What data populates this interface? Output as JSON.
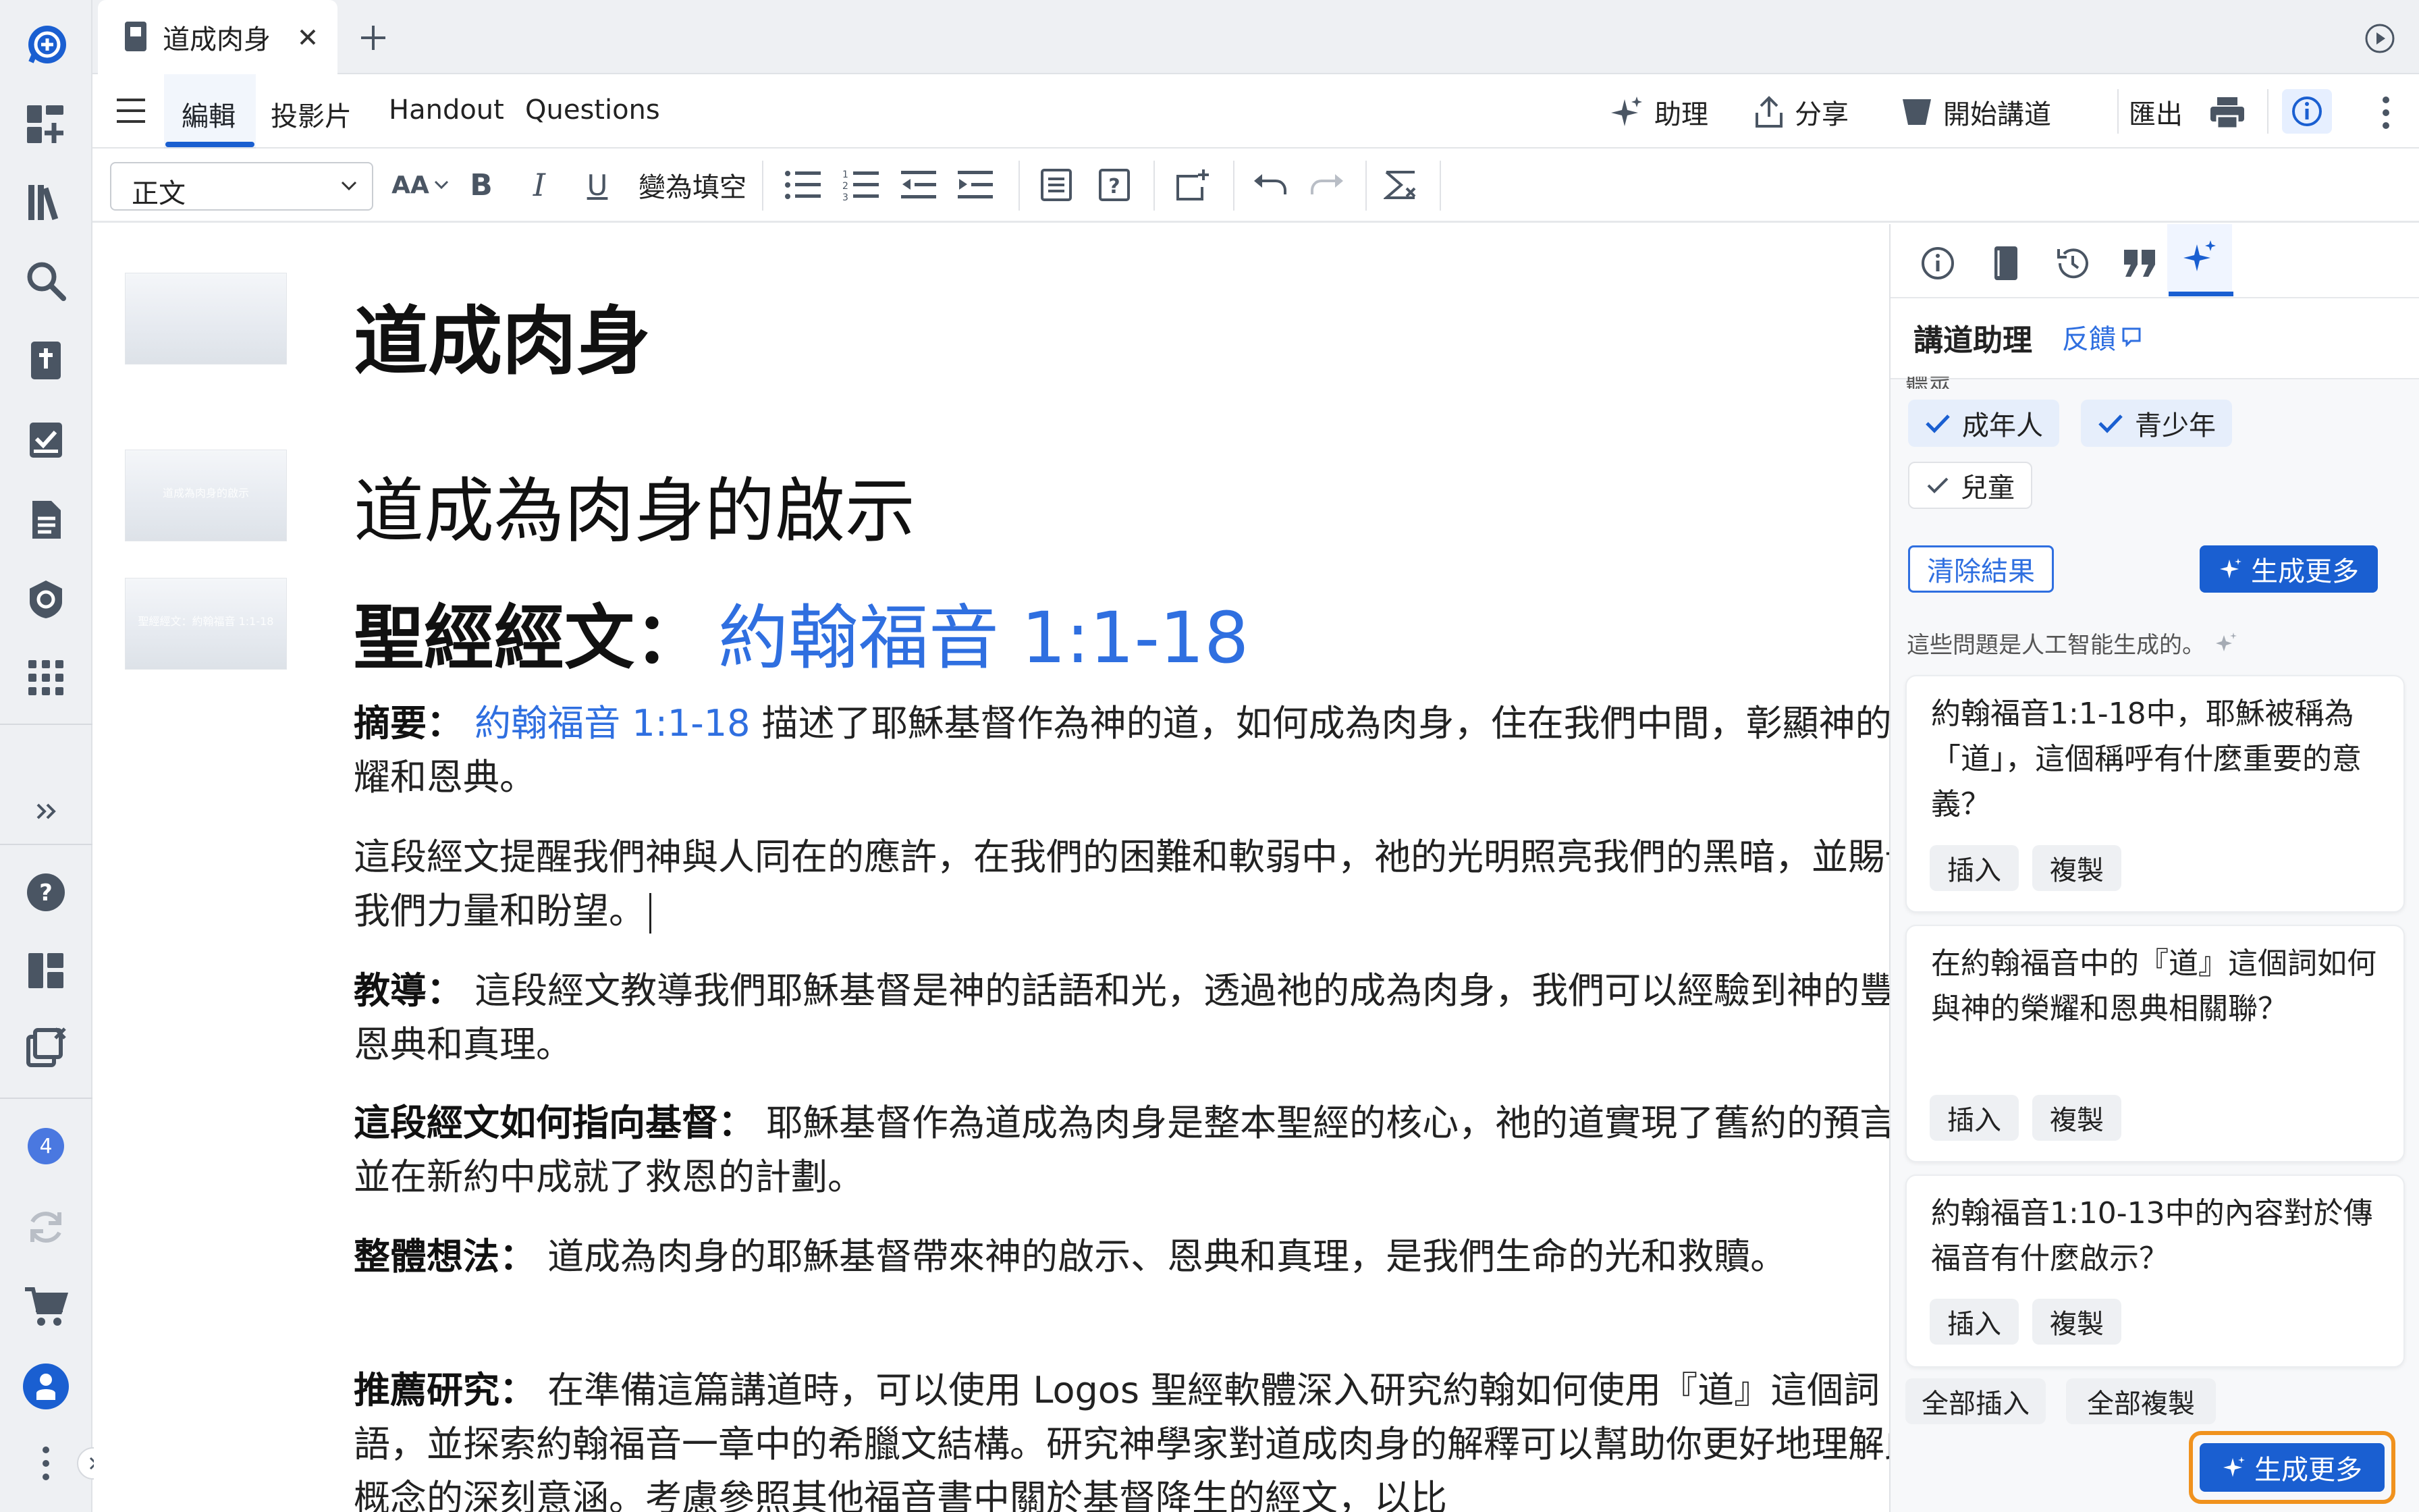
{
  "tab": {
    "title": "道成肉身"
  },
  "menu": {
    "items": [
      "編輯",
      "投影片",
      "Handout",
      "Questions"
    ],
    "active": "編輯"
  },
  "actions": {
    "assistant": "助理",
    "share": "分享",
    "preach": "開始講道",
    "export": "匯出"
  },
  "toolbar": {
    "style_value": "正文",
    "font_size_label": "AA",
    "fill_blank": "變為填空"
  },
  "sidebar": {
    "notification_count": "4"
  },
  "document": {
    "slides": [
      {
        "caption": ""
      },
      {
        "caption": "道成為肉身的啟示"
      },
      {
        "caption": "聖經經文：約翰福音 1:1-18"
      }
    ],
    "title": "道成肉身",
    "subtitle": "道成為肉身的啟示",
    "scripture_label": "聖經經文：",
    "scripture_ref": "約翰福音 1:1-18",
    "summary_label": "摘要：",
    "summary_ref": "約翰福音 1:1-18",
    "summary_text": "描述了耶穌基督作為神的道，如何成為肉身，住在我們中間，彰顯神的榮耀和恩典。",
    "reminder_text": "這段經文提醒我們神與人同在的應許，在我們的困難和軟弱中，祂的光明照亮我們的黑暗，並賜予我們力量和盼望。",
    "teaching_label": "教導：",
    "teaching_text": "這段經文教導我們耶穌基督是神的話語和光，透過祂的成為肉身，我們可以經驗到神的豐盛恩典和真理。",
    "christ_label": "這段經文如何指向基督：",
    "christ_text": "耶穌基督作為道成為肉身是整本聖經的核心，祂的道實現了舊約的預言，並在新約中成就了救恩的計劃。",
    "big_idea_label": "整體想法：",
    "big_idea_text": "道成為肉身的耶穌基督帶來神的啟示、恩典和真理，是我們生命的光和救贖。",
    "study_label": "推薦研究：",
    "study_text": "在準備這篇講道時，可以使用 Logos 聖經軟體深入研究約翰如何使用『道』這個詞語，並探索約翰福音一章中的希臘文結構。研究神學家對道成肉身的解釋可以幫助你更好地理解此概念的深刻意涵。考慮參照其他福音書中關於基督降生的經文，以比"
  },
  "panel": {
    "title": "講道助理",
    "feedback": "反饋",
    "audience_label": "聽眾",
    "audiences": [
      {
        "label": "成年人",
        "selected": true
      },
      {
        "label": "青少年",
        "selected": true
      },
      {
        "label": "兒童",
        "selected": false
      }
    ],
    "clear_results": "清除結果",
    "generate_more": "生成更多",
    "ai_note": "這些問題是人工智能生成的。",
    "questions": [
      {
        "text": "約翰福音1:1-18中，耶穌被稱為「道」，這個稱呼有什麼重要的意義？",
        "insert": "插入",
        "copy": "複製"
      },
      {
        "text": "在約翰福音中的『道』這個詞如何與神的榮耀和恩典相關聯？",
        "insert": "插入",
        "copy": "複製"
      },
      {
        "text": "約翰福音1:10-13中的內容對於傳福音有什麼啟示？",
        "insert": "插入",
        "copy": "複製"
      }
    ],
    "insert_all": "全部插入",
    "copy_all": "全部複製",
    "generate_more_bottom": "生成更多"
  },
  "colors": {
    "accent": "#2f6fe0",
    "brand_blue": "#1a5fd1",
    "highlight_orange": "#f0921e",
    "sidebar_bg": "#eef0f3"
  }
}
